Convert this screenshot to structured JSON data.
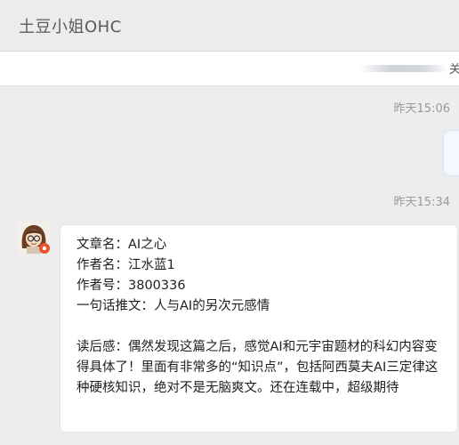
{
  "window": {
    "title": "土豆小姐OHC"
  },
  "notice": {
    "text": "关"
  },
  "messages": [
    {
      "time": "昨天15:06",
      "direction": "outgoing"
    },
    {
      "time": "昨天15:34",
      "direction": "incoming",
      "content": {
        "article_name": "文章名：AI之心",
        "author_name": "作者名：江水蓝1",
        "author_id": "作者号：3800336",
        "one_line": "一句话推文：人与AI的另次元感情",
        "review": "读后感：偶然发现这篇之后，感觉AI和元宇宙题材的科幻内容变得具体了！里面有非常多的“知识点”，包括阿西莫夫AI三定律这种硬核知识，绝对不是无脑爽文。还在连载中，超级期待"
      }
    }
  ],
  "colors": {
    "background": "#ededed",
    "bubble": "#ffffff",
    "time_text": "#9a9a9a",
    "badge": "#e8532b"
  },
  "icons": {
    "avatar": "cartoon-girl-avatar",
    "badge": "red-badge-icon"
  }
}
